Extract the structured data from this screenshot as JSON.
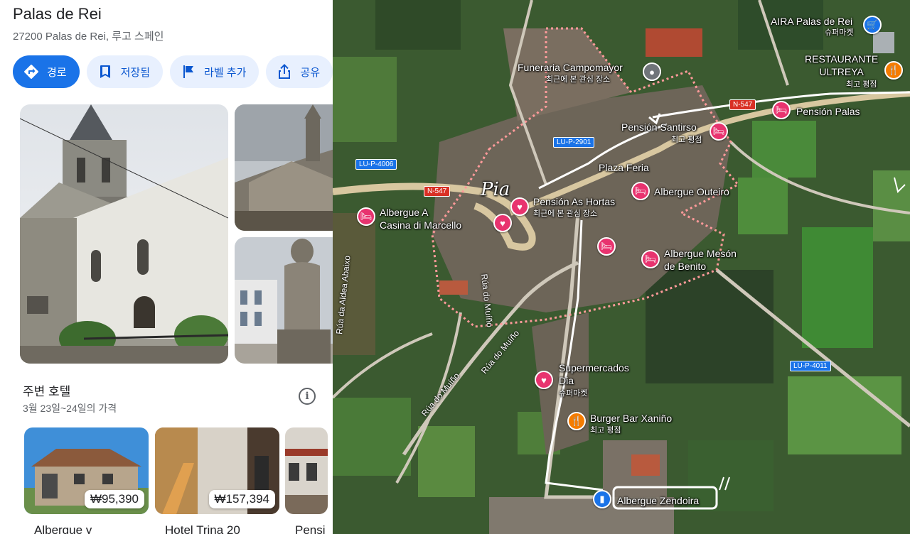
{
  "place": {
    "title": "Palas de Rei",
    "address": "27200 Palas de Rei, 루고 스페인"
  },
  "actions": [
    {
      "label": "경로",
      "icon": "directions-icon"
    },
    {
      "label": "저장됨",
      "icon": "bookmark-icon"
    },
    {
      "label": "라벨 추가",
      "icon": "flag-icon"
    },
    {
      "label": "공유",
      "icon": "share-icon"
    }
  ],
  "nearby": {
    "title": "주변 호텔",
    "dates": "3월 23일~24일의 가격",
    "hotels": [
      {
        "name": "Albergue y",
        "price": "₩95,390"
      },
      {
        "name": "Hotel Trina 20",
        "price": "₩157,394"
      },
      {
        "name": "Pensi",
        "price": ""
      }
    ]
  },
  "map": {
    "handwriting": "Pia",
    "roads": [
      "LU-P-4006",
      "N-547",
      "LU-P-2901",
      "N-547",
      "LU-P-4011"
    ],
    "streets": [
      "Rúa do Muíño",
      "Rúa do Muíño",
      "Rúa do Muíño",
      "Rúa da Aldea Abaixo"
    ],
    "places": [
      {
        "name": "AIRA Palas de Rei",
        "sub": "슈퍼마켓",
        "icon": "cart-icon"
      },
      {
        "name": "RESTAURANTE\nULTREYA",
        "sub": "최고 평점",
        "icon": "fork-knife-icon"
      },
      {
        "name": "Funeraria Campomayor",
        "sub": "최근에 본 관심 장소",
        "icon": "place-icon"
      },
      {
        "name": "Pensión Palas",
        "sub": "",
        "icon": "bed-icon"
      },
      {
        "name": "Pensión Santirso",
        "sub": "최고 평점",
        "icon": "bed-icon"
      },
      {
        "name": "Plaza Feria",
        "sub": "",
        "icon": ""
      },
      {
        "name": "Albergue Outeiro",
        "sub": "",
        "icon": "bed-icon"
      },
      {
        "name": "Pensión As Hortas",
        "sub": "최근에 본 관심 장소",
        "icon": "heart-icon"
      },
      {
        "name": "Albergue A\nCasina di Marcello",
        "sub": "",
        "icon": "bed-icon"
      },
      {
        "name": "Albergue Mesón\nde Benito",
        "sub": "",
        "icon": "bed-icon"
      },
      {
        "name": "Supermercados\nDia",
        "sub": "슈퍼마켓",
        "icon": "heart-icon"
      },
      {
        "name": "Burger Bar Xaniño",
        "sub": "최고 평점",
        "icon": "fork-knife-icon"
      },
      {
        "name": "Albergue Zendoira",
        "sub": "",
        "icon": "hostel-icon"
      }
    ]
  },
  "colors": {
    "primary": "#1a73e8",
    "chip_bg": "#e8f0fe",
    "chip_text": "#0b57d0",
    "poi_pink": "#e8336f",
    "poi_orange": "#f57c00"
  }
}
